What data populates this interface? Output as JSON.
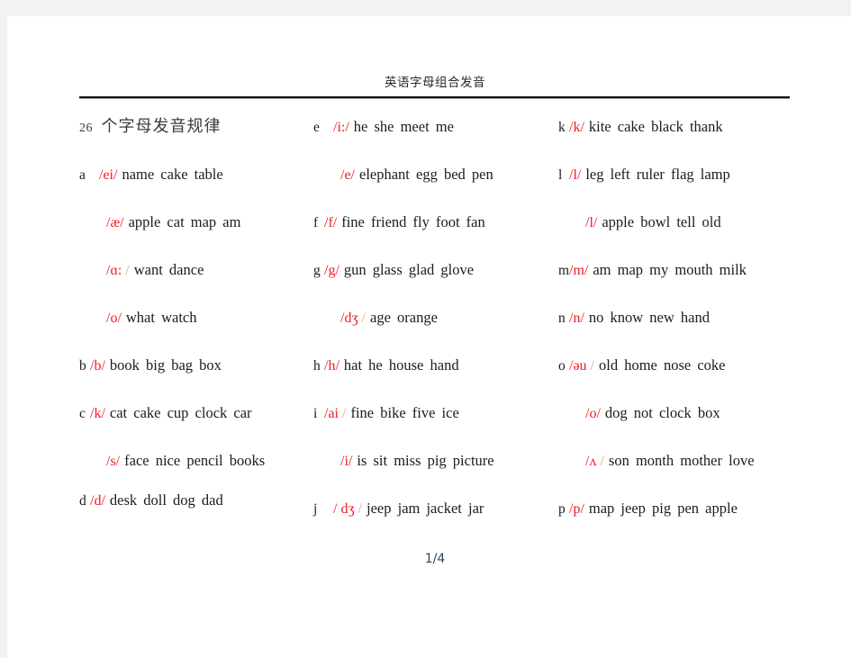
{
  "header": {
    "title": "英语字母组合发音"
  },
  "footer": {
    "page_number": "1/4"
  },
  "colors": {
    "ipa_red": "#ee1c24",
    "ipa_faint": "#f29aa0",
    "text": "#1c1c1c",
    "rule": "#171717",
    "page_background": "#ffffff",
    "canvas_background": "#f2f2f2"
  },
  "section": {
    "number": "26",
    "title_cn": "个字母发音规律"
  },
  "columns": [
    {
      "id": "column-1",
      "entries": [
        {
          "letter": "a",
          "ipa": "/ei/",
          "ipa_tail": "",
          "words": "name cake table"
        },
        {
          "letter": "",
          "ipa": "/æ/",
          "ipa_tail": "",
          "words": "apple cat map am"
        },
        {
          "letter": "",
          "ipa": "/ɑ:",
          "ipa_tail": "/",
          "words": "want dance"
        },
        {
          "letter": "",
          "ipa": "/o/",
          "ipa_tail": "",
          "words": "what watch"
        },
        {
          "letter": "b",
          "ipa": "/b/",
          "ipa_tail": "",
          "words": "book big bag box"
        },
        {
          "letter": "c",
          "ipa": "/k/",
          "ipa_tail": "",
          "words": "cat cake cup clock car"
        },
        {
          "letter": "",
          "ipa": "/s/",
          "ipa_tail": "",
          "words": "face nice pencil books"
        },
        {
          "letter": "d",
          "ipa": "/d/",
          "ipa_tail": "",
          "words": "desk doll dog dad"
        }
      ]
    },
    {
      "id": "column-2",
      "entries": [
        {
          "letter": "e",
          "ipa": "/i:/",
          "ipa_tail": "",
          "words": "he she meet me"
        },
        {
          "letter": "",
          "ipa": "/e/",
          "ipa_tail": "",
          "words": "elephant egg bed pen"
        },
        {
          "letter": "f",
          "ipa": "/f/",
          "ipa_tail": "",
          "words": "fine friend fly foot fan"
        },
        {
          "letter": "g",
          "ipa": "/g/",
          "ipa_tail": "",
          "words": "gun glass glad glove"
        },
        {
          "letter": "",
          "ipa": "/dʒ",
          "ipa_tail": "/",
          "words": "age orange"
        },
        {
          "letter": "h",
          "ipa": "/h/",
          "ipa_tail": "",
          "words": "hat he house hand"
        },
        {
          "letter": "i",
          "ipa": "/ai",
          "ipa_tail": "/",
          "words": "fine bike five ice"
        },
        {
          "letter": "",
          "ipa": "/i/",
          "ipa_tail": "",
          "words": "is sit miss pig picture"
        },
        {
          "letter": "j",
          "ipa": "/ dʒ",
          "ipa_tail": "/",
          "words": "jeep jam jacket jar"
        }
      ]
    },
    {
      "id": "column-3",
      "entries": [
        {
          "letter": "k",
          "ipa": "/k/",
          "ipa_tail": "",
          "words": "kite cake black thank"
        },
        {
          "letter": "l",
          "ipa": "/l/",
          "ipa_tail": "",
          "words": "leg left ruler flag lamp"
        },
        {
          "letter": "",
          "ipa": "/l/",
          "ipa_tail": "",
          "words": "apple bowl tell old"
        },
        {
          "letter": "m",
          "ipa": "/m/",
          "ipa_tail": "",
          "words": "am map my mouth milk"
        },
        {
          "letter": "n",
          "ipa": "/n/",
          "ipa_tail": "",
          "words": "no know new hand"
        },
        {
          "letter": "o",
          "ipa": "/əu",
          "ipa_tail": "/",
          "words": "old home nose coke"
        },
        {
          "letter": "",
          "ipa": "/o/",
          "ipa_tail": "",
          "words": "dog not clock box"
        },
        {
          "letter": "",
          "ipa": "/ʌ",
          "ipa_tail": "/",
          "words": "son month mother love"
        },
        {
          "letter": "p",
          "ipa": "/p/",
          "ipa_tail": "",
          "words": "map jeep pig pen apple"
        }
      ]
    }
  ]
}
